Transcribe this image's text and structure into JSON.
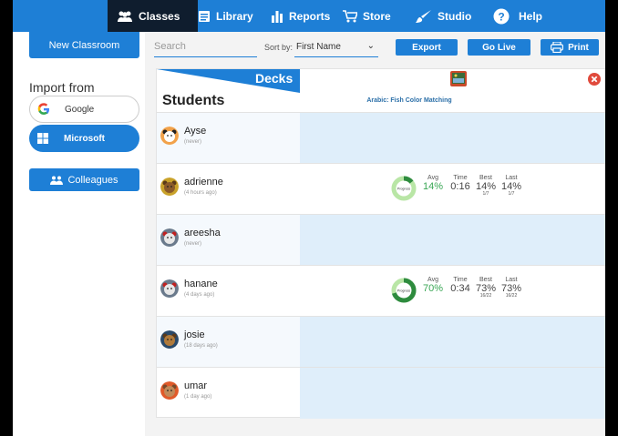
{
  "nav": {
    "classes": "Classes",
    "library": "Library",
    "reports": "Reports",
    "store": "Store",
    "studio": "Studio",
    "help": "Help"
  },
  "sidebar": {
    "new_classroom": "New Classroom",
    "import_from": "Import from",
    "google": "Google",
    "microsoft": "Microsoft",
    "colleagues": "Colleagues"
  },
  "toolbar": {
    "search_placeholder": "Search",
    "sort_label": "Sort by:",
    "sort_value": "First Name",
    "export": "Export",
    "go_live": "Go Live",
    "print": "Print"
  },
  "table": {
    "decks_label": "Decks",
    "students_label": "Students",
    "deck_title": "Arabic: Fish Color Matching"
  },
  "stat_headers": {
    "avg": "Avg",
    "time": "Time",
    "best": "Best",
    "last": "Last"
  },
  "progress_label": "Progress",
  "students": [
    {
      "name": "Ayse",
      "sub": "(never)",
      "has_stats": false
    },
    {
      "name": "adrienne",
      "sub": "(4 hours ago)",
      "has_stats": true,
      "avg": "14%",
      "avg_fraction": 0.14,
      "time": "0:16",
      "best": "14%",
      "best_frac": "1/7",
      "last": "14%",
      "last_frac": "1/7"
    },
    {
      "name": "areesha",
      "sub": "(never)",
      "has_stats": false
    },
    {
      "name": "hanane",
      "sub": "(4 days ago)",
      "has_stats": true,
      "avg": "70%",
      "avg_fraction": 0.7,
      "time": "0:34",
      "best": "73%",
      "best_frac": "16/22",
      "last": "73%",
      "last_frac": "16/22"
    },
    {
      "name": "josie",
      "sub": "(18 days ago)",
      "has_stats": false
    },
    {
      "name": "umar",
      "sub": "(1 day ago)",
      "has_stats": false
    }
  ],
  "colors": {
    "brand_blue": "#1e7fd6",
    "nav_active": "#0f1d2e",
    "row_blank": "#dfeefa",
    "progress_green": "#2e8b3e",
    "close_red": "#e04a3c"
  }
}
